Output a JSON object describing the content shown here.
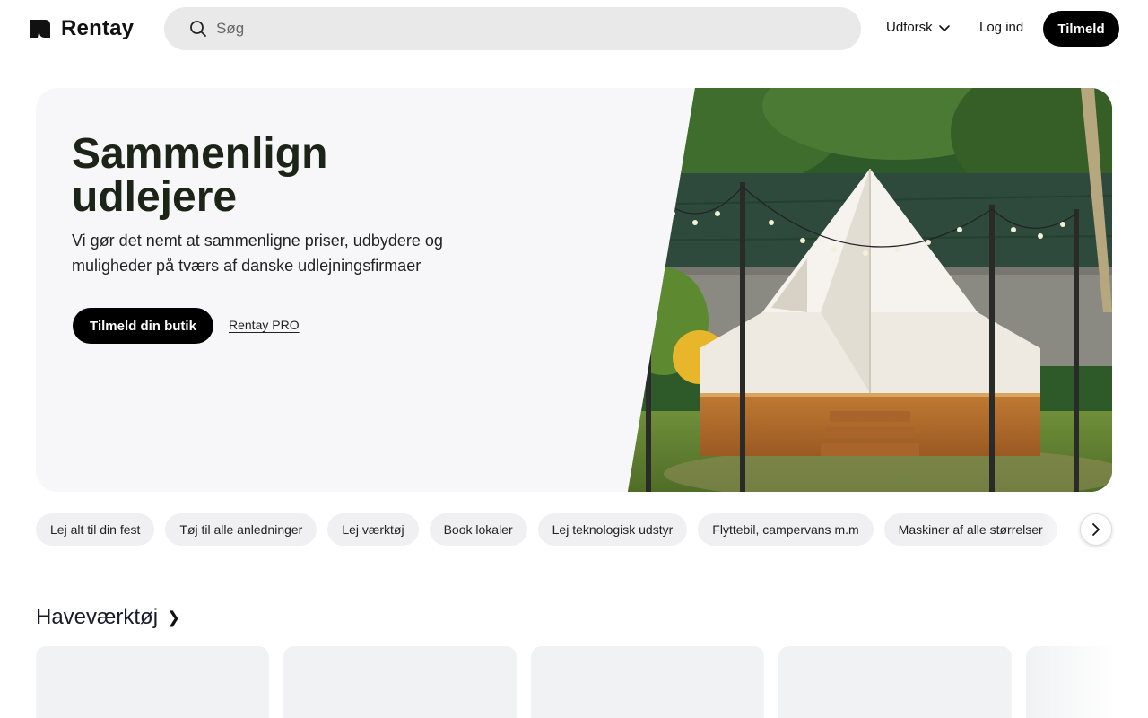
{
  "header": {
    "brand": "Rentay",
    "logo_icon": "rentay-logo-icon",
    "search_placeholder": "Søg",
    "explore_label": "Udforsk",
    "login_label": "Log ind",
    "signup_label": "Tilmeld"
  },
  "hero": {
    "title": "Sammenlign udlejere",
    "subtitle": "Vi gør det nemt at sammenligne priser, udbydere og muligheder på tværs af danske udlejningsfirmaer",
    "cta_label": "Tilmeld din butik",
    "pro_link": "Rentay PRO",
    "image_subject": "tent-photo"
  },
  "categories": [
    "Lej alt til din fest",
    "Tøj til alle anledninger",
    "Lej værktøj",
    "Book lokaler",
    "Lej teknologisk udstyr",
    "Flyttebil, campervans m.m",
    "Maskiner af alle størrelser"
  ],
  "section": {
    "title": "Haveværktøj",
    "chevron": "❯"
  },
  "colors": {
    "primary_button": "#000000",
    "hero_bg": "#f7f7f9",
    "chip_bg": "#f0f0f2",
    "search_bg": "#e9e9e9"
  }
}
